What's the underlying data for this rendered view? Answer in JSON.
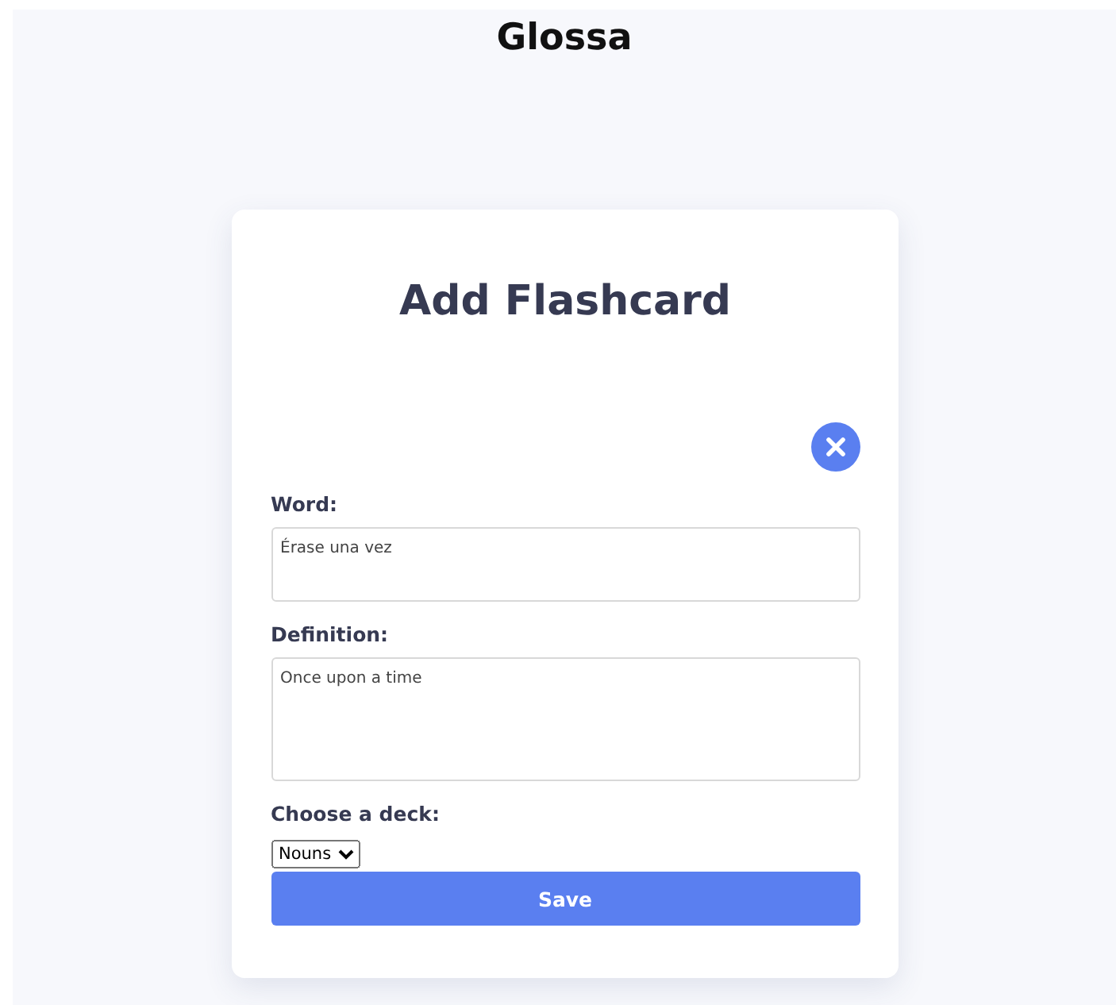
{
  "app_title": "Glossa",
  "form": {
    "heading": "Add Flashcard",
    "word": {
      "label": "Word:",
      "value": "Érase una vez"
    },
    "definition": {
      "label": "Definition:",
      "value": "Once upon a time"
    },
    "deck": {
      "label": "Choose a deck:",
      "value": "Nouns"
    },
    "save_button": "Save"
  }
}
